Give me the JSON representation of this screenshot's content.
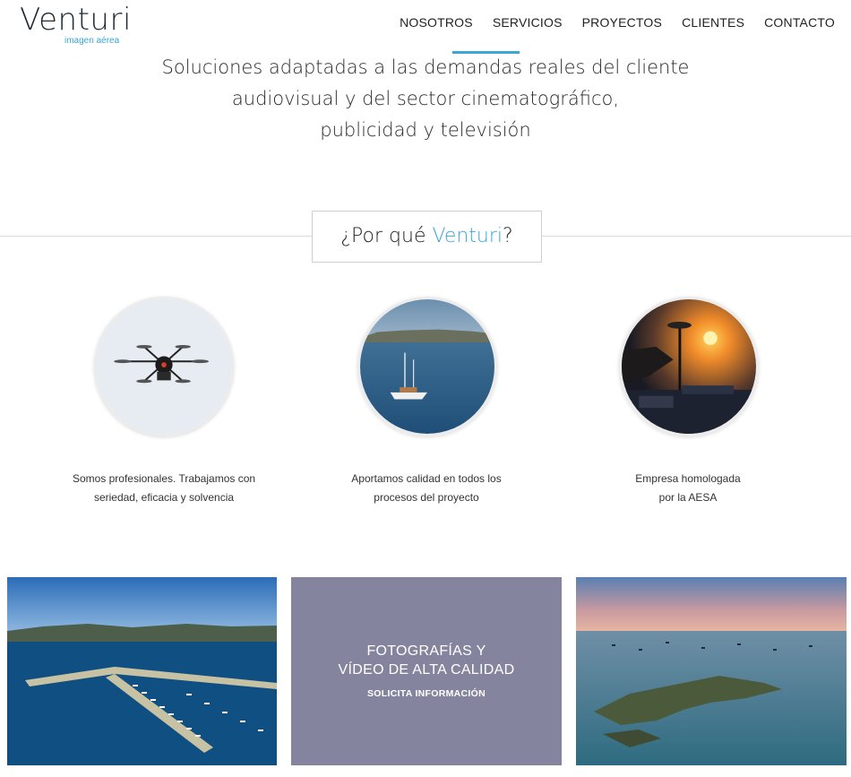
{
  "brand": {
    "name": "Venturi",
    "tagline": "imagen aérea",
    "accent_color": "#3aa7d6"
  },
  "nav": {
    "items": [
      {
        "label": "NOSOTROS",
        "active": true
      },
      {
        "label": "SERVICIOS",
        "active": false
      },
      {
        "label": "PROYECTOS",
        "active": false
      },
      {
        "label": "CLIENTES",
        "active": false
      },
      {
        "label": "CONTACTO",
        "active": false
      }
    ]
  },
  "intro": {
    "lines": [
      "Soluciones adaptadas a las demandas reales del cliente",
      "audiovisual y del sector cinematográfico,",
      "publicidad y televisión"
    ]
  },
  "why": {
    "prefix": "¿Por qué ",
    "brand": "Venturi",
    "suffix": "?"
  },
  "features": [
    {
      "icon": "drone-photo",
      "caption_lines": [
        "Somos profesionales. Trabajamos con",
        "seriedad, eficacia y solvencia"
      ]
    },
    {
      "icon": "sailboat-photo",
      "caption_lines": [
        "Aportamos calidad en todos los",
        "procesos del proyecto"
      ]
    },
    {
      "icon": "sunset-equipment-photo",
      "caption_lines": [
        "Empresa homologada",
        "por la AESA"
      ]
    }
  ],
  "promo": {
    "title_lines": [
      "FOTOGRAFÍAS Y",
      "VÍDEO DE ALTA CALIDAD"
    ],
    "cta": "SOLICITA INFORMACIÓN",
    "bg_color": "#85849e"
  }
}
